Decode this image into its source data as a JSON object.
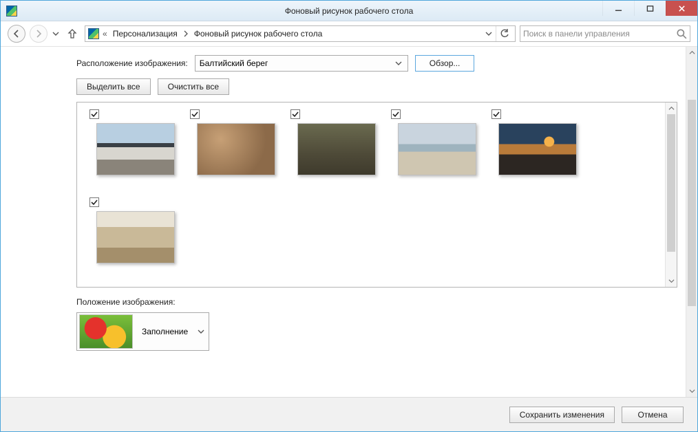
{
  "title": "Фоновый рисунок рабочего стола",
  "breadcrumb": {
    "prefix": "«",
    "seg1": "Персонализация",
    "seg2": "Фоновый рисунок рабочего стола"
  },
  "search": {
    "placeholder": "Поиск в панели управления"
  },
  "location_label": "Расположение изображения:",
  "location_select": "Балтийский берег",
  "browse_label": "Обзор...",
  "select_all": "Выделить все",
  "clear_all": "Очистить все",
  "thumbs": [
    {
      "checked": true,
      "name": "wallpaper-1"
    },
    {
      "checked": true,
      "name": "wallpaper-2"
    },
    {
      "checked": true,
      "name": "wallpaper-3"
    },
    {
      "checked": true,
      "name": "wallpaper-4"
    },
    {
      "checked": true,
      "name": "wallpaper-5"
    },
    {
      "checked": true,
      "name": "wallpaper-6"
    }
  ],
  "position_label": "Положение изображения:",
  "position_value": "Заполнение",
  "save_label": "Сохранить изменения",
  "cancel_label": "Отмена"
}
